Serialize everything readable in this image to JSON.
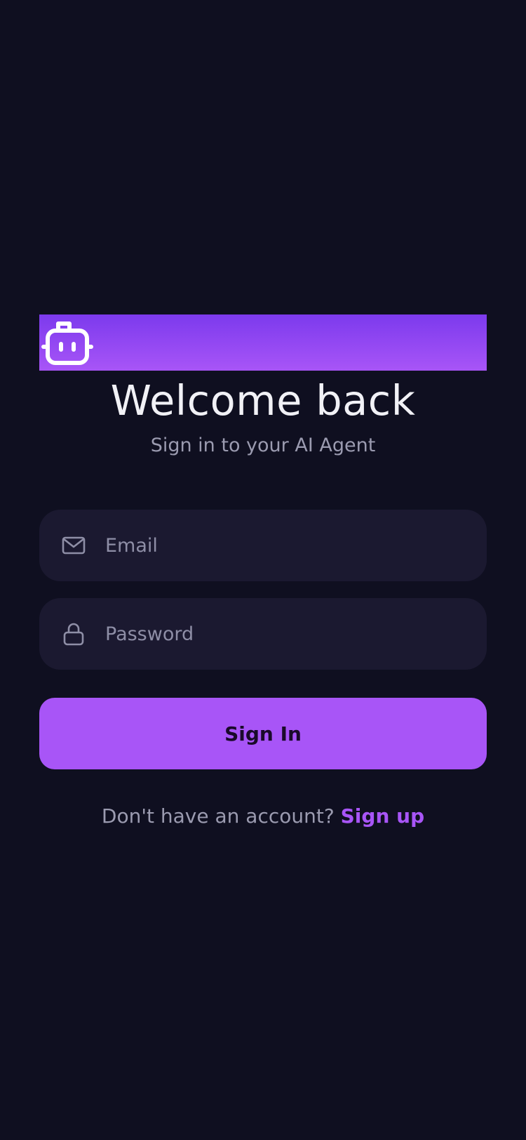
{
  "logo": {
    "icon": "robot-icon",
    "gradient_start": "#7c3aed",
    "gradient_end": "#a855f7"
  },
  "title": "Welcome back",
  "subtitle": "Sign in to your AI Agent",
  "email": {
    "icon": "mail-icon",
    "placeholder": "Email",
    "value": ""
  },
  "password": {
    "icon": "lock-icon",
    "placeholder": "Password",
    "value": ""
  },
  "signin_label": "Sign In",
  "footer": {
    "prompt": "Don't have an account?",
    "link": "Sign up"
  },
  "colors": {
    "background": "#0f0f20",
    "field": "#1b1930",
    "accent": "#a855f7"
  }
}
